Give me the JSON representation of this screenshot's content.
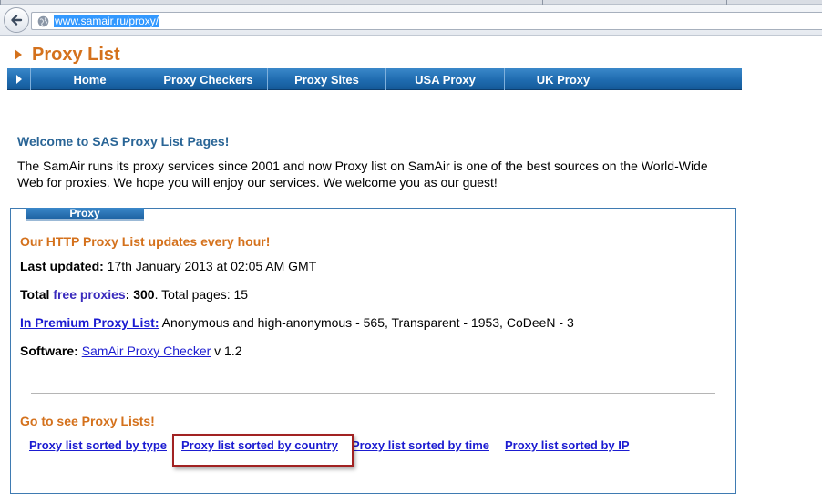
{
  "browser": {
    "url": "www.samair.ru/proxy/",
    "icons": {
      "back": "back-arrow-icon",
      "site": "globe-icon"
    }
  },
  "page": {
    "title": "Proxy List",
    "menu": [
      "Home",
      "Proxy Checkers",
      "Proxy Sites",
      "USA Proxy",
      "UK Proxy"
    ]
  },
  "welcome": {
    "title": "Welcome to SAS Proxy List Pages!",
    "text": "The SamAir runs its proxy services since 2001 and now Proxy list on SamAir is one of the best sources on the World-Wide Web for proxies. We hope you will enjoy our services. We welcome you as our guest!"
  },
  "proxy_panel": {
    "tab_label": "Proxy",
    "heading": "Our HTTP Proxy List updates every hour!",
    "last_updated_label": "Last updated:",
    "last_updated_value": " 17th January 2013 at 02:05 AM GMT",
    "total_label": "Total ",
    "free_proxies_link": "free proxies",
    "total_colon": ": ",
    "total_count": "300",
    "total_pages": ". Total pages: 15",
    "premium_link": "In Premium Proxy List:",
    "premium_text": " Anonymous and high-anonymous - 565, Transparent - 1953, CoDeeN - 3",
    "software_label": "Software:",
    "software_link": "SamAir Proxy Checker",
    "software_version": " v 1.2",
    "go_heading": "Go to see Proxy Lists!",
    "list_links": [
      "Proxy list sorted by type",
      "Proxy list sorted by country",
      "Proxy list sorted by time",
      "Proxy list sorted by IP"
    ]
  },
  "colors": {
    "accent_orange": "#d4711c",
    "menu_blue": "#1f6cb0",
    "link_blue": "#1b1bd1",
    "highlight_red": "#a12222"
  }
}
